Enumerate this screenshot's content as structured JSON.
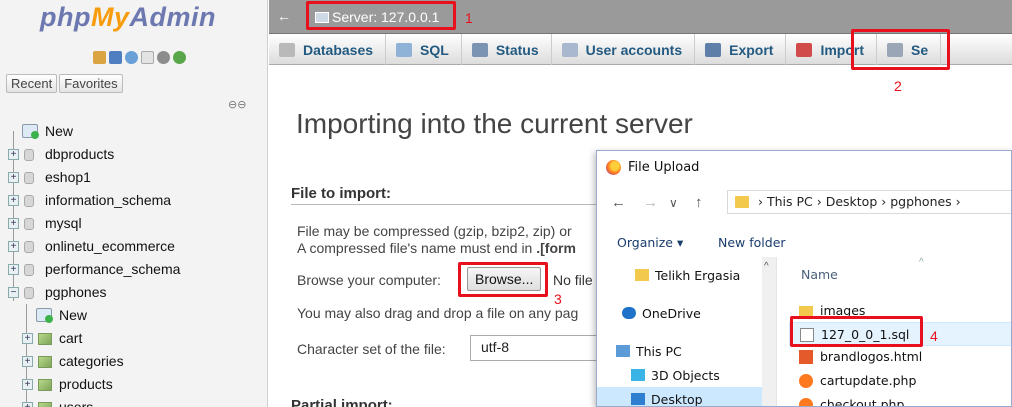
{
  "app": {
    "logo": {
      "php": "php",
      "my": "My",
      "admin": "Admin"
    },
    "recent_label": "Recent",
    "favorites_label": "Favorites",
    "quick_icon_colors": [
      "#d9a441",
      "#4f7fc0",
      "#6aa0d8",
      "#cfcfcf",
      "#8c8c8c",
      "#5aa64b"
    ]
  },
  "tree": {
    "items": [
      {
        "label": "New",
        "type": "new",
        "level": 0
      },
      {
        "label": "dbproducts",
        "type": "db",
        "level": 0
      },
      {
        "label": "eshop1",
        "type": "db",
        "level": 0
      },
      {
        "label": "information_schema",
        "type": "db",
        "level": 0
      },
      {
        "label": "mysql",
        "type": "db",
        "level": 0
      },
      {
        "label": "onlinetu_ecommerce",
        "type": "db",
        "level": 0
      },
      {
        "label": "performance_schema",
        "type": "db",
        "level": 0
      },
      {
        "label": "pgphones",
        "type": "db",
        "level": 0,
        "expanded": true
      },
      {
        "label": "New",
        "type": "new",
        "level": 1
      },
      {
        "label": "cart",
        "type": "table",
        "level": 1
      },
      {
        "label": "categories",
        "type": "table",
        "level": 1
      },
      {
        "label": "products",
        "type": "table",
        "level": 1
      },
      {
        "label": "users",
        "type": "table",
        "level": 1
      }
    ]
  },
  "serverbar": {
    "back_arrow": "←",
    "crumb": "Server: 127.0.0.1"
  },
  "tabs": [
    {
      "label": "Databases",
      "icon": "database-icon",
      "color": "#b9b9b9"
    },
    {
      "label": "SQL",
      "icon": "sql-icon",
      "color": "#8fb3d6"
    },
    {
      "label": "Status",
      "icon": "status-icon",
      "color": "#7c94b4"
    },
    {
      "label": "User accounts",
      "icon": "users-icon",
      "color": "#a9b8cf"
    },
    {
      "label": "Export",
      "icon": "export-icon",
      "color": "#5e7fa8"
    },
    {
      "label": "Import",
      "icon": "import-icon",
      "color": "#d24b4b"
    },
    {
      "label": "Se",
      "icon": "wrench-icon",
      "color": "#9aa6b6"
    }
  ],
  "main": {
    "title": "Importing into the current server",
    "file_to_import": "File to import:",
    "hint1": "File may be compressed (gzip, bzip2, zip) or",
    "hint2_prefix": "A compressed file's name must end in ",
    "hint2_bold": ".[form",
    "browse_label": "Browse your computer:",
    "browse_button": "Browse...",
    "no_file": "No file",
    "drag_text": "You may also drag and drop a file on any pag",
    "charset_label": "Character set of the file:",
    "charset_value": "utf-8",
    "partial_import": "Partial import:"
  },
  "dialog": {
    "title": "File Upload",
    "nav_back": "←",
    "nav_forward": "→",
    "nav_dropdown": "∨",
    "nav_up": "↑",
    "address_path": "›  This PC  ›  Desktop  ›  pgphones  ›",
    "organize": "Organize ▾",
    "new_folder": "New folder",
    "nav_items": [
      {
        "label": "Telikh Ergasia",
        "icon": "folder-icon",
        "color": "#f2c94c"
      },
      {
        "label": "OneDrive",
        "icon": "cloud-icon",
        "color": "#1e73c8"
      },
      {
        "label": "This PC",
        "icon": "computer-icon",
        "color": "#5a9bd8"
      },
      {
        "label": "3D Objects",
        "icon": "cube-icon",
        "color": "#3ab3e6"
      },
      {
        "label": "Desktop",
        "icon": "desktop-icon",
        "color": "#2f7fd1"
      }
    ],
    "column_name": "Name",
    "files": [
      {
        "label": "images",
        "icon": "folder-icon",
        "color": "#f2c94c"
      },
      {
        "label": "127_0_0_1.sql",
        "icon": "file-icon",
        "color": "#ffffff"
      },
      {
        "label": "brandlogos.html",
        "icon": "html-file-icon",
        "color": "#e55a2a"
      },
      {
        "label": "cartupdate.php",
        "icon": "firefox-icon",
        "color": "#ff7a1f"
      },
      {
        "label": "checkout.php",
        "icon": "firefox-icon",
        "color": "#ff7a1f"
      }
    ]
  },
  "annotations": [
    "1",
    "2",
    "3",
    "4"
  ],
  "accent_red": "#e8101c"
}
